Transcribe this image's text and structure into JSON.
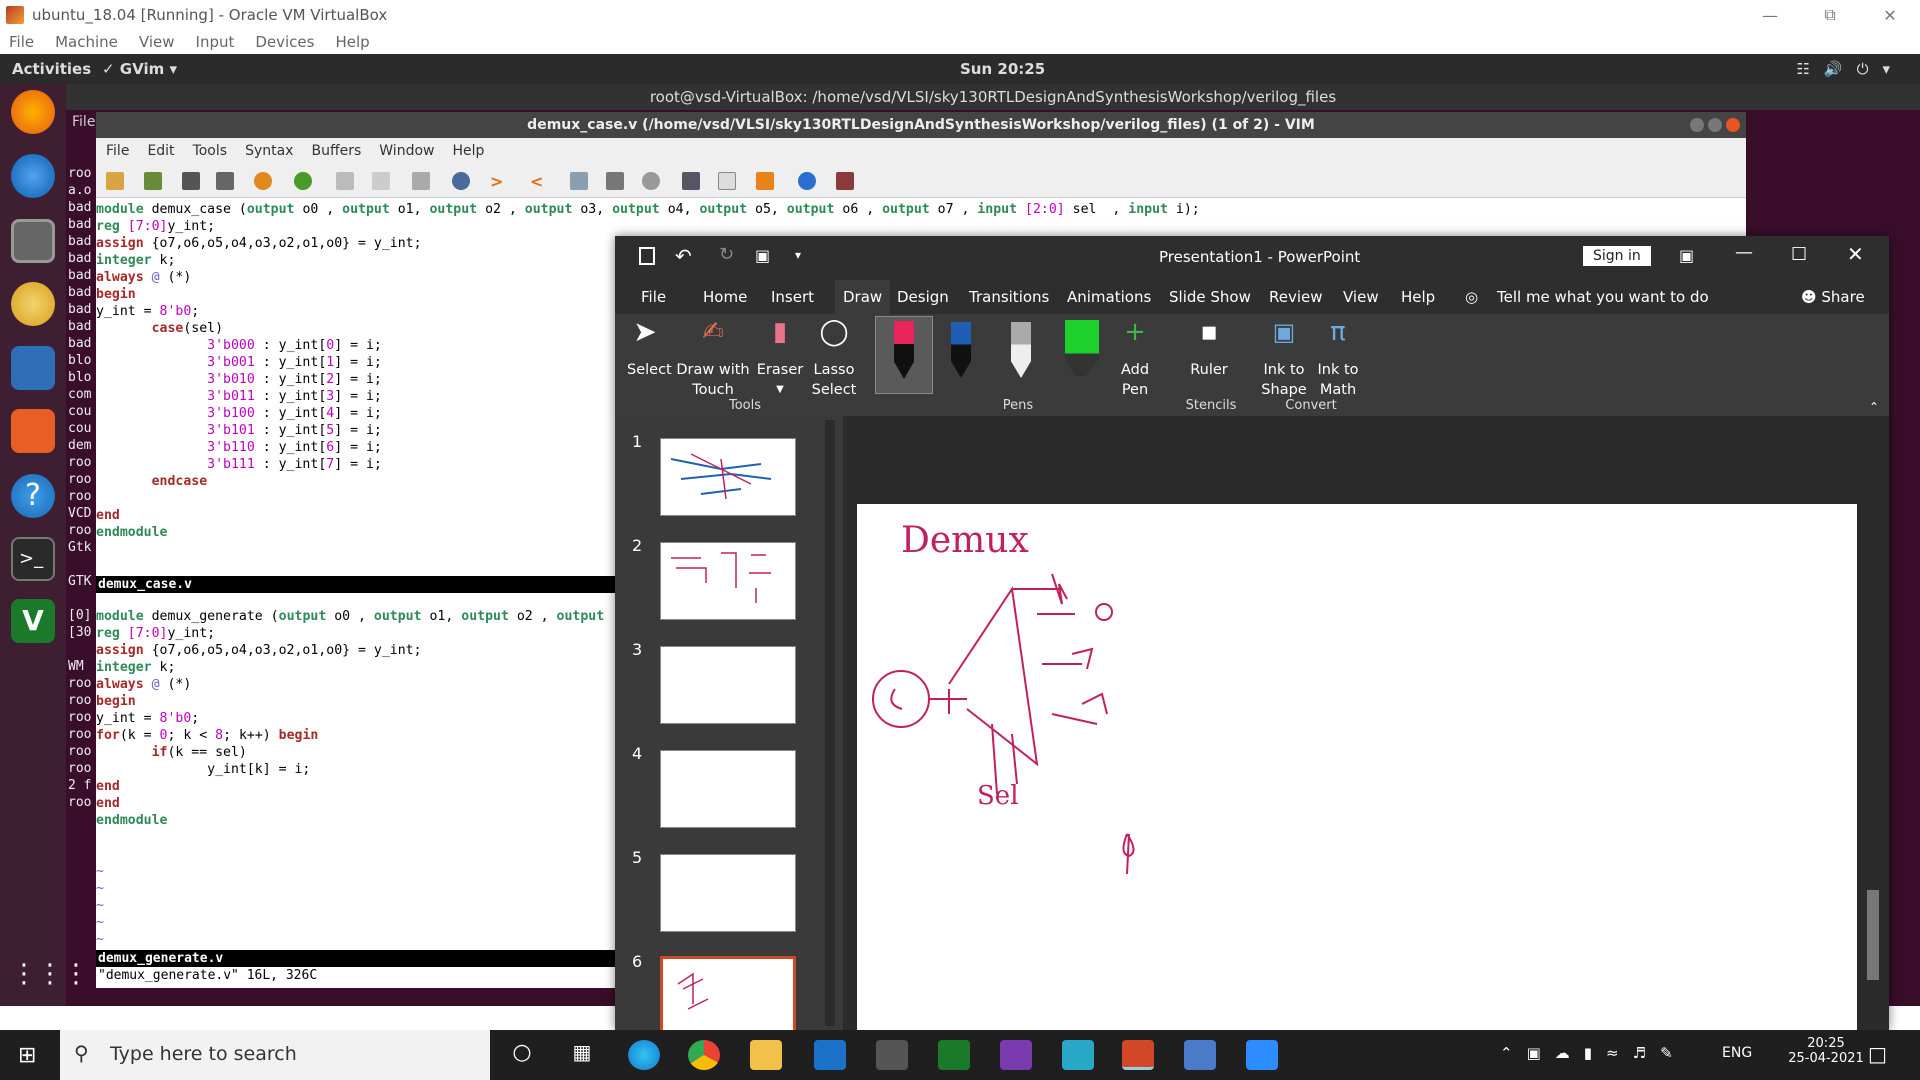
{
  "vbox": {
    "title": "ubuntu_18.04 [Running] - Oracle VM VirtualBox",
    "menu": [
      "File",
      "Machine",
      "View",
      "Input",
      "Devices",
      "Help"
    ]
  },
  "ubuntu": {
    "activities": "Activities",
    "app": "GVim",
    "clock": "Sun 20:25"
  },
  "terminal": {
    "title": "root@vsd-VirtualBox: /home/vsd/VLSI/sky130RTLDesignAndSynthesisWorkshop/verilog_files",
    "file_label": "File",
    "left_text": [
      "roo",
      "a.o",
      "bad",
      "bad",
      "bad",
      "bad",
      "bad",
      "bad",
      "bad",
      "bad",
      "bad",
      "blo",
      "blo",
      "com",
      "cou",
      "cou",
      "dem",
      "roo",
      "roo",
      "roo",
      "VCD",
      "roo",
      "Gtk",
      "",
      "GTK",
      "",
      "[0]",
      "[30",
      "",
      "WM",
      "roo",
      "roo",
      "roo",
      "roo",
      "roo",
      "roo",
      "2 f",
      "roo"
    ]
  },
  "gvim": {
    "title": "demux_case.v (/home/vsd/VLSI/sky130RTLDesignAndSynthesisWorkshop/verilog_files) (1 of 2) - VIM",
    "menu": [
      "File",
      "Edit",
      "Tools",
      "Syntax",
      "Buffers",
      "Window",
      "Help"
    ],
    "status1": "demux_case.v",
    "status2": "demux_generate.v",
    "msg": "\"demux_generate.v\" 16L, 326C"
  },
  "ppt": {
    "title": "Presentation1  -  PowerPoint",
    "signin": "Sign in",
    "tabs": [
      "File",
      "Home",
      "Insert",
      "Draw",
      "Design",
      "Transitions",
      "Animations",
      "Slide Show",
      "Review",
      "View",
      "Help"
    ],
    "tell": "Tell me what you want to do",
    "share": "Share",
    "tools": {
      "select": "Select",
      "touch1": "Draw with",
      "touch2": "Touch",
      "eraser": "Eraser",
      "lasso1": "Lasso",
      "lasso2": "Select",
      "addpen1": "Add",
      "addpen2": "Pen",
      "ruler": "Ruler",
      "shape1": "Ink to",
      "shape2": "Shape",
      "math1": "Ink to",
      "math2": "Math"
    },
    "groups": {
      "tools": "Tools",
      "pens": "Pens",
      "stencils": "Stencils",
      "convert": "Convert"
    },
    "slides": [
      "1",
      "2",
      "3",
      "4",
      "5",
      "6"
    ],
    "ink": {
      "demux": "Demux",
      "sel": "Sel"
    }
  },
  "taskbar": {
    "search": "Type here to search",
    "lang": "ENG",
    "time": "20:25",
    "date": "25-04-2021"
  }
}
